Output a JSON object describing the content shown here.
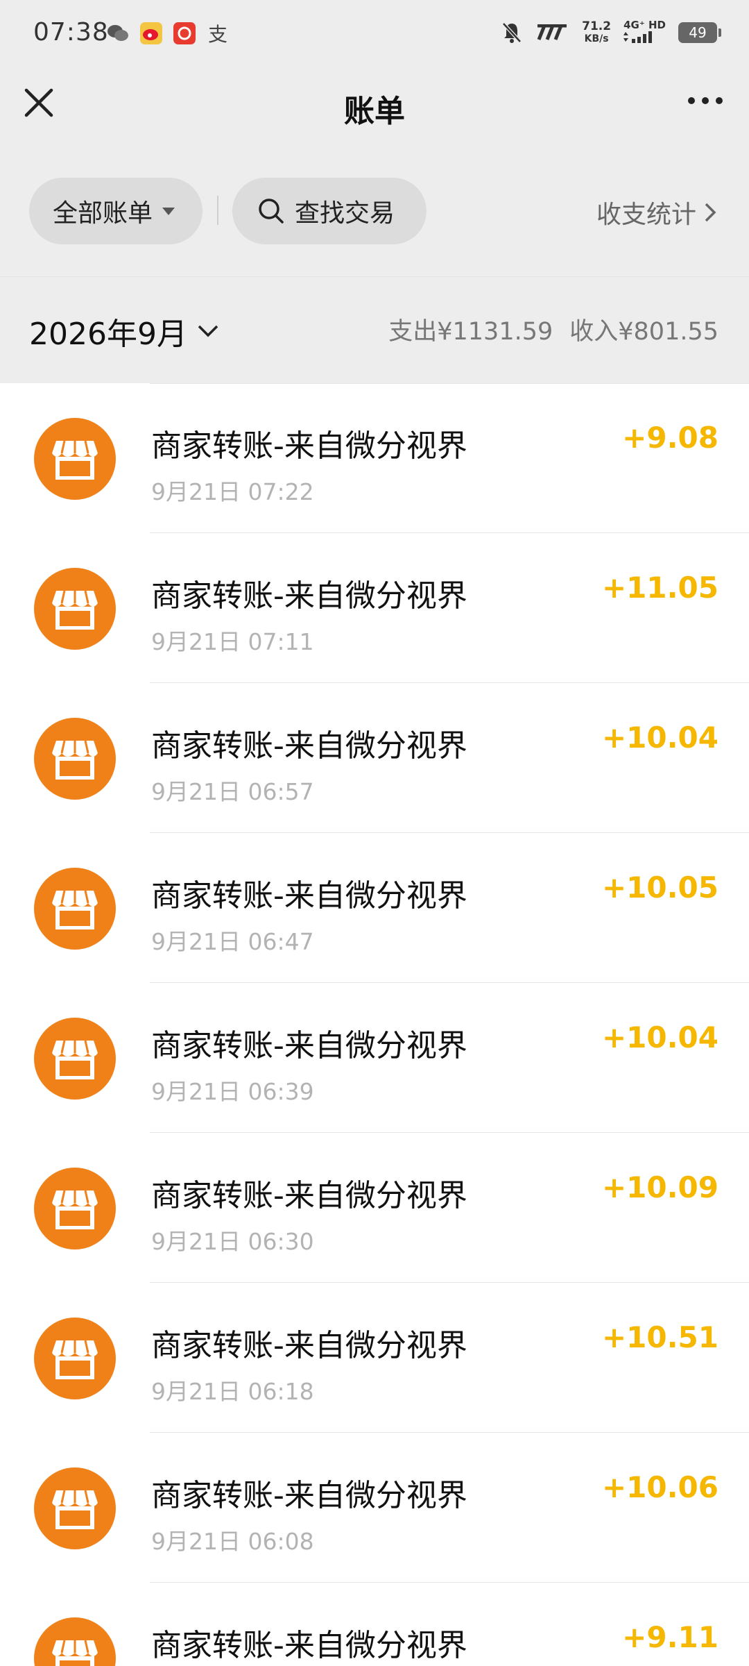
{
  "status_bar": {
    "time": "07:38",
    "app_icons": [
      "wechat-icon",
      "weibo-icon",
      "red-app-icon",
      "alipay-icon"
    ],
    "alipay_glyph": "支",
    "net_speed_value": "71.2",
    "net_speed_unit": "KB/s",
    "network_type": "4G⁺ HD",
    "battery": "49"
  },
  "navbar": {
    "title": "账单"
  },
  "filters": {
    "all_bills": "全部账单",
    "search": "查找交易",
    "stats": "收支统计"
  },
  "month": {
    "label": "2026年9月",
    "expense": "支出¥1131.59",
    "income": "收入¥801.55"
  },
  "colors": {
    "accent_amount": "#f5b700",
    "avatar_bg": "#f08118"
  },
  "transactions": [
    {
      "title": "商家转账-来自微分视界",
      "time": "9月21日 07:22",
      "amount": "+9.08"
    },
    {
      "title": "商家转账-来自微分视界",
      "time": "9月21日 07:11",
      "amount": "+11.05"
    },
    {
      "title": "商家转账-来自微分视界",
      "time": "9月21日 06:57",
      "amount": "+10.04"
    },
    {
      "title": "商家转账-来自微分视界",
      "time": "9月21日 06:47",
      "amount": "+10.05"
    },
    {
      "title": "商家转账-来自微分视界",
      "time": "9月21日 06:39",
      "amount": "+10.04"
    },
    {
      "title": "商家转账-来自微分视界",
      "time": "9月21日 06:30",
      "amount": "+10.09"
    },
    {
      "title": "商家转账-来自微分视界",
      "time": "9月21日 06:18",
      "amount": "+10.51"
    },
    {
      "title": "商家转账-来自微分视界",
      "time": "9月21日 06:08",
      "amount": "+10.06"
    },
    {
      "title": "商家转账-来自微分视界",
      "time": "",
      "amount": "+9.11"
    }
  ]
}
